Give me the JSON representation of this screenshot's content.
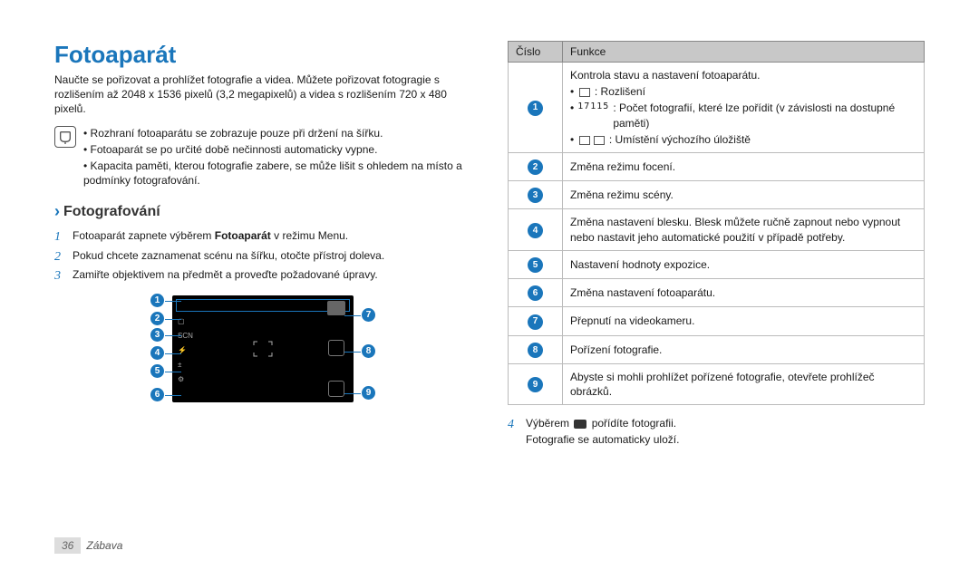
{
  "page": {
    "number": "36",
    "section": "Zábava"
  },
  "heading": "Fotoaparát",
  "intro": "Naučte se pořizovat a prohlížet fotografie a videa. Můžete pořizovat fotogragie s rozlišením až 2048 x 1536 pixelů (3,2 megapixelů) a videa s rozlišením 720 x 480 pixelů.",
  "notes": [
    "Rozhraní fotoaparátu se zobrazuje pouze při držení na šířku.",
    "Fotoaparát se po určité době nečinnosti automaticky vypne.",
    "Kapacita paměti, kterou fotografie zabere, se může lišit s ohledem na místo a podmínky fotografování."
  ],
  "sub_heading": "Fotografování",
  "steps": [
    {
      "num": "1",
      "text_before": "Fotoaparát zapnete výběrem ",
      "bold": "Fotoaparát",
      "text_after": " v režimu Menu."
    },
    {
      "num": "2",
      "text_before": "Pokud chcete zaznamenat scénu na šířku, otočte přístroj doleva.",
      "bold": "",
      "text_after": ""
    },
    {
      "num": "3",
      "text_before": "Zamiřte objektivem na předmět a proveďte požadované úpravy.",
      "bold": "",
      "text_after": ""
    }
  ],
  "table": {
    "head_a": "Číslo",
    "head_b": "Funkce",
    "rows": [
      {
        "n": "1",
        "desc": "Kontrola stavu a nastavení fotoaparátu.",
        "bullets": [
          {
            "icon": true,
            "text": " : Rozlišení"
          },
          {
            "icon": false,
            "prefix_icon": true,
            "text": " : Počet fotografií, které lze pořídit (v závislosti na dostupné paměti)"
          },
          {
            "icon": true,
            "text": " : Umístění výchozího úložiště"
          }
        ]
      },
      {
        "n": "2",
        "desc": "Změna režimu focení."
      },
      {
        "n": "3",
        "desc": "Změna režimu scény."
      },
      {
        "n": "4",
        "desc": "Změna nastavení blesku. Blesk můžete ručně zapnout nebo vypnout nebo nastavit jeho automatické použití v případě potřeby."
      },
      {
        "n": "5",
        "desc": "Nastavení hodnoty expozice."
      },
      {
        "n": "6",
        "desc": "Změna nastavení fotoaparátu."
      },
      {
        "n": "7",
        "desc": "Přepnutí na videokameru."
      },
      {
        "n": "8",
        "desc": "Pořízení fotografie."
      },
      {
        "n": "9",
        "desc": "Abyste si mohli prohlížet pořízené fotografie, otevřete prohlížeč obrázků."
      }
    ]
  },
  "step4": {
    "num": "4",
    "before": "Výběrem ",
    "after": " pořídíte fotografii.",
    "line2": "Fotografie se automaticky uloží."
  },
  "prefix_num_icon_text": "17115"
}
